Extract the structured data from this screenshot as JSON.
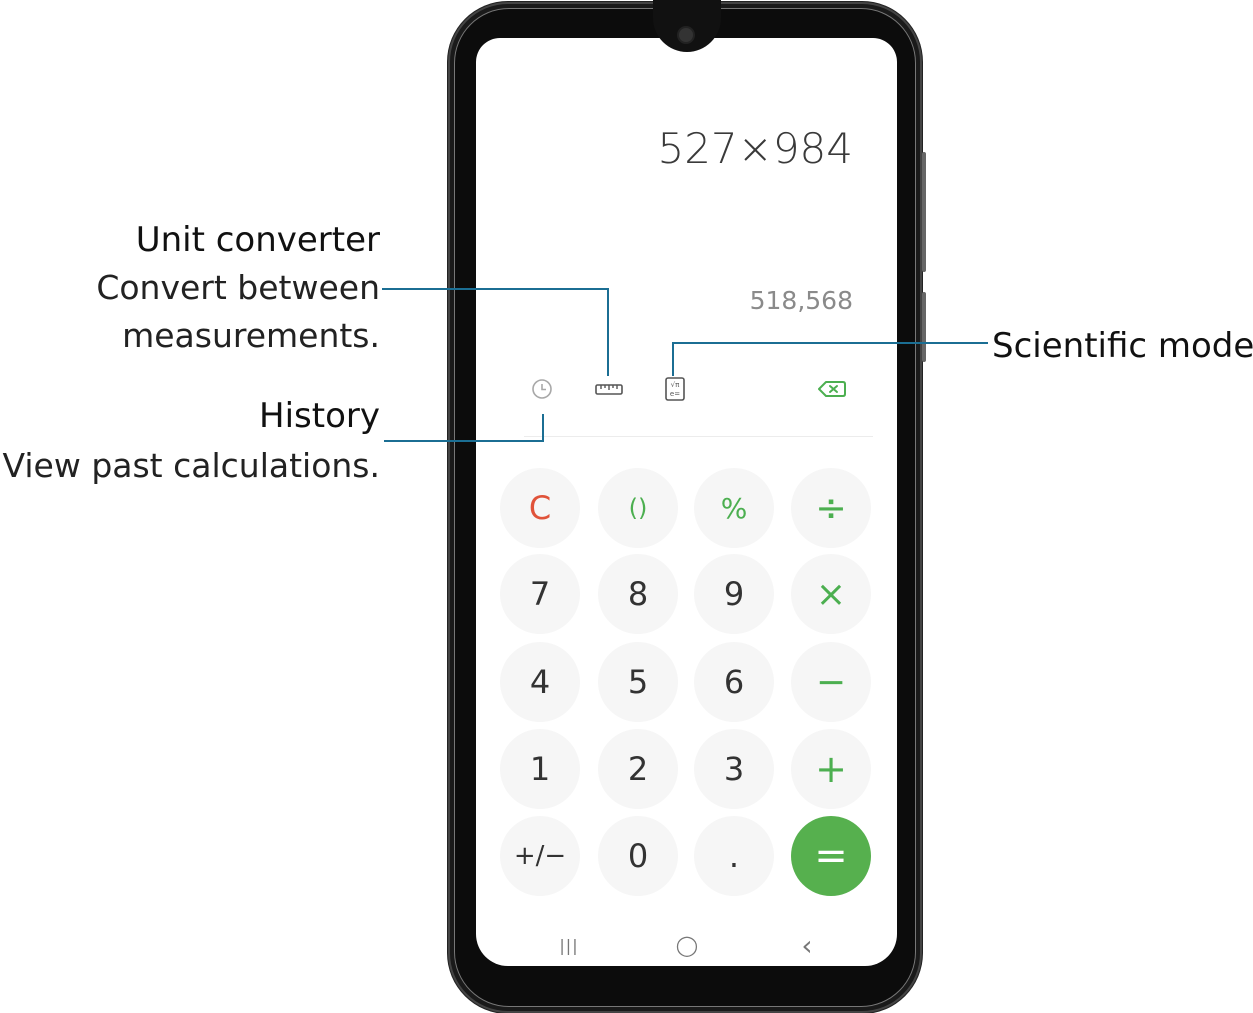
{
  "annotations": {
    "unit_converter": {
      "title": "Unit converter",
      "desc_line1": "Convert between",
      "desc_line2": "measurements."
    },
    "history": {
      "title": "History",
      "desc": "View past calculations."
    },
    "scientific": {
      "title": "Scientific mode"
    }
  },
  "calculator": {
    "expression": "527×984",
    "preview": "518,568",
    "toolbar": {
      "history_icon": "clock-icon",
      "unit_icon": "ruler-icon",
      "scientific_icon": "scientific-icon",
      "backspace_icon": "backspace-icon"
    },
    "keys": [
      [
        "C",
        "()",
        "%",
        "÷"
      ],
      [
        "7",
        "8",
        "9",
        "×"
      ],
      [
        "4",
        "5",
        "6",
        "−"
      ],
      [
        "1",
        "2",
        "3",
        "+"
      ],
      [
        "+/−",
        "0",
        ".",
        "="
      ]
    ]
  },
  "navbar": {
    "recents": "|||",
    "home": "◯",
    "back": "‹"
  },
  "colors": {
    "accent_green": "#56b04e",
    "clear_red": "#e0533a",
    "leader_line": "#1b6e93"
  }
}
